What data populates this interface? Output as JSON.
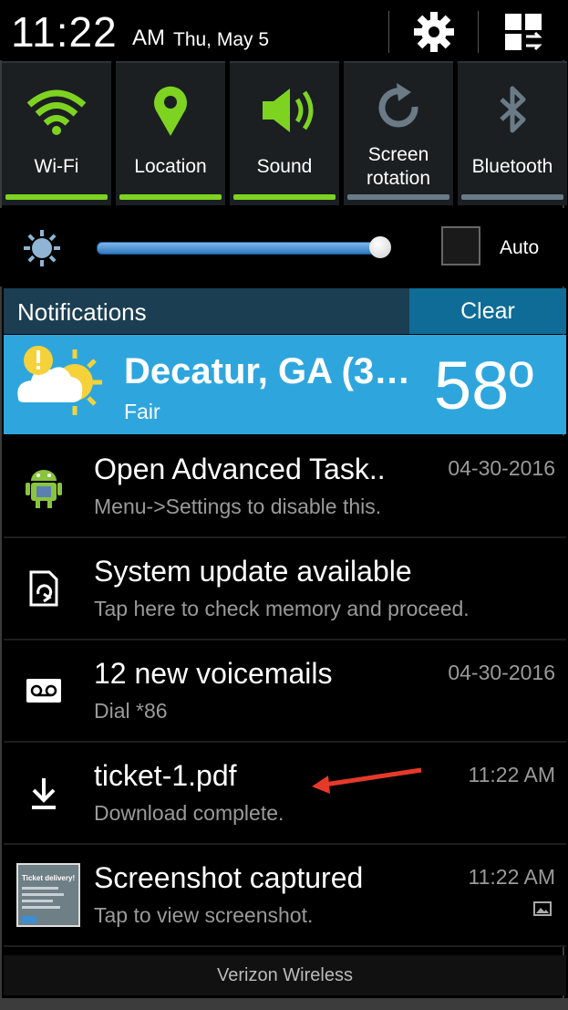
{
  "status": {
    "time": "11:22",
    "ampm": "AM",
    "date": "Thu, May 5",
    "settings_icon": "gear-icon",
    "edit_icon": "grid-edit-icon"
  },
  "toggles": [
    {
      "label": "Wi-Fi",
      "icon": "wifi-icon",
      "on": true
    },
    {
      "label": "Location",
      "icon": "location-icon",
      "on": true
    },
    {
      "label": "Sound",
      "icon": "sound-icon",
      "on": true
    },
    {
      "label_line1": "Screen",
      "label_line2": "rotation",
      "icon": "rotation-icon",
      "on": false
    },
    {
      "label": "Bluetooth",
      "icon": "bluetooth-icon",
      "on": false
    }
  ],
  "brightness": {
    "icon": "brightness-icon",
    "level": 0.97,
    "auto_label": "Auto",
    "auto_checked": false
  },
  "notifications_header": {
    "title": "Notifications",
    "clear_label": "Clear"
  },
  "weather": {
    "city": "Decatur, GA (3…",
    "condition": "Fair",
    "temperature": "58º"
  },
  "notifications": [
    {
      "title": "Open Advanced Task..",
      "subtitle": "Menu->Settings to disable this.",
      "time": "04-30-2016",
      "icon": "android-icon"
    },
    {
      "title": "System update available",
      "subtitle": "Tap here to check memory and proceed.",
      "time": "",
      "icon": "system-update-icon"
    },
    {
      "title": "12 new voicemails",
      "subtitle": "Dial *86",
      "time": "04-30-2016",
      "icon": "voicemail-icon"
    },
    {
      "title": "ticket-1.pdf",
      "subtitle": "Download complete.",
      "time": "11:22 AM",
      "icon": "download-icon"
    },
    {
      "title": "Screenshot captured",
      "subtitle": "Tap to view screenshot.",
      "time": "11:22 AM",
      "icon": "screenshot-thumbnail"
    }
  ],
  "screenshot_thumb_text": "Ticket delivery!",
  "carrier": "Verizon Wireless",
  "colors": {
    "toggle_on": "#7ed321",
    "toggle_off": "#6a7a86",
    "weather_bg": "#2ea6dd",
    "header_bg": "#1b3e52",
    "clear_bg": "#0e6c96",
    "annotation_arrow": "#e53a2a"
  }
}
